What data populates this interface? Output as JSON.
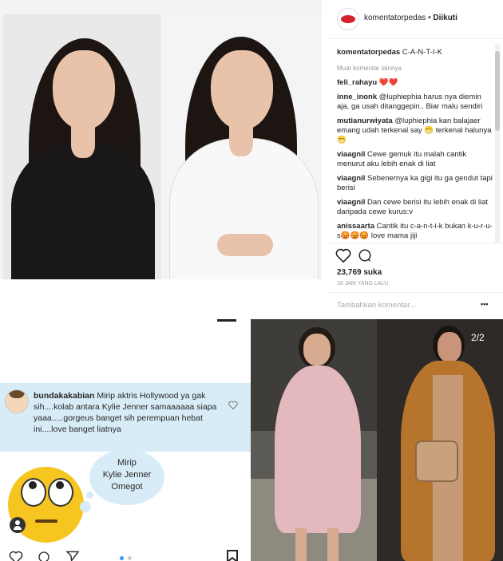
{
  "post": {
    "account": "komentatorpedas",
    "separator": "•",
    "follow_status": "Diikuti",
    "caption_user": "komentatorpedas",
    "caption_text": "C-A-N-T-I-K",
    "load_more": "Muat komentar lainnya",
    "comments": [
      {
        "user": "feli_rahayu",
        "text": "❤️❤️"
      },
      {
        "user": "inne_inonk",
        "text": "@luphiephia harus nya diemin aja, ga usah ditanggepin.. Biar malu sendiri"
      },
      {
        "user": "mutianurwiyata",
        "text": "@luphiephia kan balajaer emang udah terkenal say 😁 terkenal halunya 😁"
      },
      {
        "user": "viaagnil",
        "text": "Cewe gemuk itu malah cantik menurut aku lebih enak di liat"
      },
      {
        "user": "viaagnil",
        "text": "Sebenernya ka gigi itu ga gendut tapi berisi"
      },
      {
        "user": "viaagnil",
        "text": "Dan cewe berisi itu lebih enak di liat daripada cewe kurus:v"
      },
      {
        "user": "anissaarta",
        "text": "Cantik itu c-a-n-t-i-k bukan k-u-r-u-s😡😡😡 love mama jiji"
      }
    ],
    "likes": "23,769 suka",
    "time": "16 JAM YANG LALU",
    "add_comment_placeholder": "Tambahkan komentar...",
    "more": "•••"
  },
  "screenshot_comment": {
    "user": "bundakakabian",
    "text": "Mirip aktris Hollywood ya gak sih....kolab antara  Kylie Jenner samaaaaaa siapa yaaa.....gorgeus banget sih perempuan hebat ini....love banget liatnya"
  },
  "bubble_text_1": "Mirip",
  "bubble_text_2": "Kylie Jenner",
  "bubble_text_3": "Omegot",
  "photo2_counter": "2/2"
}
